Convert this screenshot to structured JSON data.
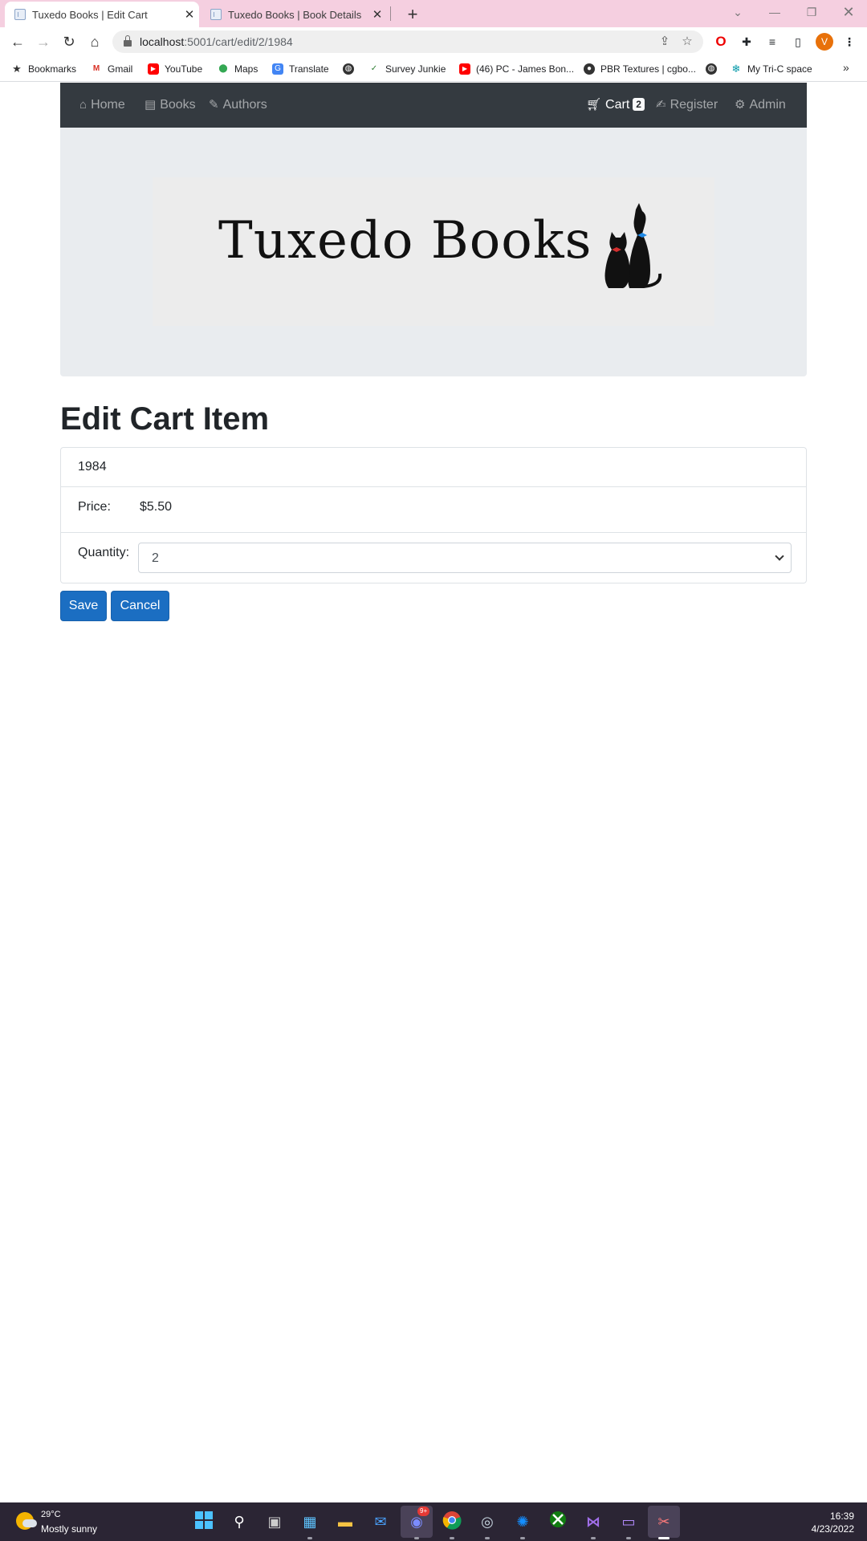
{
  "browser": {
    "tabs": [
      {
        "title": "Tuxedo Books | Edit Cart",
        "active": true
      },
      {
        "title": "Tuxedo Books | Book Details",
        "active": false
      }
    ],
    "url_host": "localhost",
    "url_path": ":5001/cart/edit/2/1984",
    "bookmarks": [
      {
        "label": "Bookmarks",
        "icon": "star-icon"
      },
      {
        "label": "Gmail",
        "icon": "gmail-icon"
      },
      {
        "label": "YouTube",
        "icon": "youtube-icon"
      },
      {
        "label": "Maps",
        "icon": "maps-icon"
      },
      {
        "label": "Translate",
        "icon": "translate-icon"
      },
      {
        "label": "",
        "icon": "globe-icon"
      },
      {
        "label": "Survey Junkie",
        "icon": "survey-junkie-icon"
      },
      {
        "label": "(46) PC - James Bon...",
        "icon": "youtube-icon"
      },
      {
        "label": "PBR Textures | cgbo...",
        "icon": "palette-icon"
      },
      {
        "label": "",
        "icon": "globe-icon"
      },
      {
        "label": "My Tri-C space",
        "icon": "tri-c-icon"
      }
    ],
    "profile_initial": "V"
  },
  "site": {
    "nav": {
      "home": "Home",
      "books": "Books",
      "authors": "Authors",
      "cart": "Cart",
      "cart_count": "2",
      "register": "Register",
      "admin": "Admin"
    },
    "banner_text": "Tuxedo Books"
  },
  "page": {
    "title": "Edit Cart Item",
    "book_title": "1984",
    "price_label": "Price:",
    "price_value": "$5.50",
    "quantity_label": "Quantity:",
    "quantity_value": "2",
    "save_label": "Save",
    "cancel_label": "Cancel"
  },
  "taskbar": {
    "weather_temp": "29°C",
    "weather_desc": "Mostly sunny",
    "time": "16:39",
    "date": "4/23/2022",
    "discord_badge": "9+"
  },
  "colors": {
    "navbar": "#343a40",
    "jumbotron": "#e9ecef",
    "primary_button": "#1b6ec2",
    "tabstrip": "#f5cfe0"
  }
}
